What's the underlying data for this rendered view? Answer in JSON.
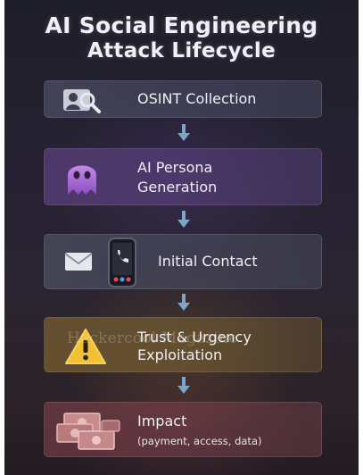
{
  "title": {
    "line1": "AI Social Engineering",
    "line2": "Attack Lifecycle"
  },
  "steps": [
    {
      "label": "OSINT Collection",
      "icon": "person-search-icon"
    },
    {
      "label_line1": "AI Persona",
      "label_line2": "Generation",
      "icon": "ghost-icon"
    },
    {
      "label": "Initial Contact",
      "icon": "envelope-phone-icon"
    },
    {
      "label_line1": "Trust & Urgency",
      "label_line2": "Exploitation",
      "icon": "warning-icon"
    },
    {
      "label": "Impact",
      "sublabel": "(payment, access, data)",
      "icon": "cash-icon"
    }
  ],
  "connector_icon": "arrow-down-icon",
  "watermark": "Hackercool Magazine",
  "colors": {
    "background": "#262233",
    "arrow": "#7fa3c9",
    "warning": "#f2c030",
    "ghost": "#b07ad8"
  }
}
